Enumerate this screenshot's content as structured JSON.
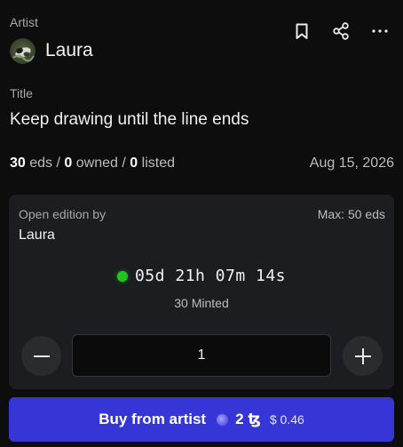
{
  "artist": {
    "label": "Artist",
    "name": "Laura"
  },
  "actions": {
    "bookmark_icon": "bookmark-icon",
    "share_icon": "share-icon",
    "more_icon": "more-icon"
  },
  "title": {
    "label": "Title",
    "text": "Keep drawing until the line ends"
  },
  "stats": {
    "editions": "30",
    "editions_label": "eds",
    "owned": "0",
    "owned_label": "owned",
    "listed": "0",
    "listed_label": "listed",
    "separator": "/",
    "date": "Aug 15, 2026"
  },
  "mint": {
    "edition_label": "Open edition by",
    "edition_artist": "Laura",
    "max": "Max: 50 eds",
    "countdown": "05d 21h 07m 14s",
    "minted": "30 Minted",
    "quantity": "1",
    "status_color": "#21c521"
  },
  "buy": {
    "label": "Buy from artist",
    "price": "2 ꜩ",
    "usd": "$ 0.46",
    "color": "#3636d6"
  }
}
